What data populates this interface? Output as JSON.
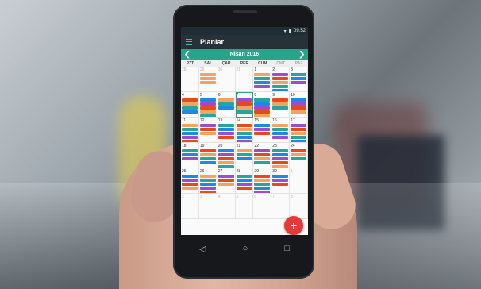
{
  "status": {
    "time": "09:52"
  },
  "appbar": {
    "title": "Planlar"
  },
  "month": {
    "label": "Nisan 2016"
  },
  "weekdays": [
    "PZT",
    "SAL",
    "ÇAR",
    "PER",
    "CUM",
    "CMT",
    "PAZ"
  ],
  "days": [
    [
      "28",
      "29",
      "30",
      "31",
      "1",
      "2",
      "3"
    ],
    [
      "4",
      "5",
      "6",
      "7",
      "8",
      "9",
      "10"
    ],
    [
      "11",
      "12",
      "13",
      "14",
      "15",
      "16",
      "17"
    ],
    [
      "18",
      "19",
      "20",
      "21",
      "22",
      "23",
      "24"
    ],
    [
      "25",
      "26",
      "27",
      "28",
      "29",
      "30",
      "1"
    ],
    [
      "2",
      "3",
      "4",
      "5",
      "6",
      "7",
      "8"
    ]
  ],
  "today_index": 10,
  "event_colors": {
    "purple": "#9c4dcc",
    "teal": "#26a69a",
    "red": "#e64a19",
    "blue": "#1e88e5",
    "orange": "#f4a261"
  },
  "fab": {
    "label": "+"
  },
  "nav": {
    "back": "◁",
    "home": "○",
    "recent": "□"
  }
}
